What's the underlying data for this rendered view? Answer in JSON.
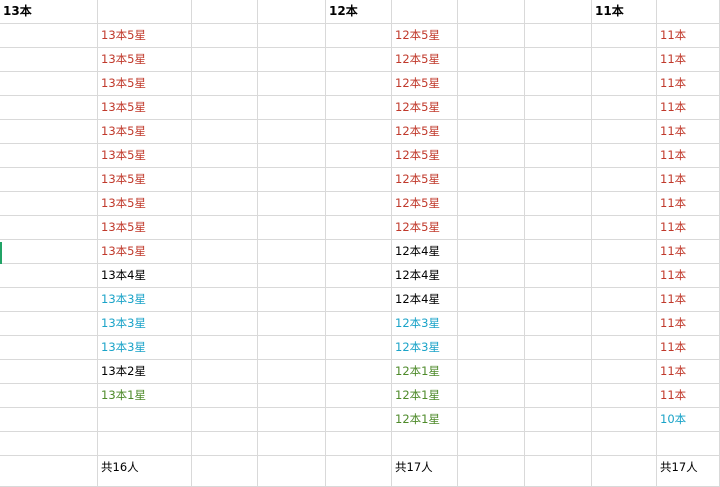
{
  "colors": {
    "red": "#c0392b",
    "black": "#000000",
    "cyan": "#1aa3c8",
    "green": "#4e8a2a",
    "gridline": "#d9d9d9",
    "selection": "#21a366"
  },
  "groups": [
    {
      "header": "13本",
      "total": "共16人",
      "entries": [
        {
          "text": "13本5星",
          "color": "red"
        },
        {
          "text": "13本5星",
          "color": "red"
        },
        {
          "text": "13本5星",
          "color": "red"
        },
        {
          "text": "13本5星",
          "color": "red"
        },
        {
          "text": "13本5星",
          "color": "red"
        },
        {
          "text": "13本5星",
          "color": "red"
        },
        {
          "text": "13本5星",
          "color": "red"
        },
        {
          "text": "13本5星",
          "color": "red"
        },
        {
          "text": "13本5星",
          "color": "red"
        },
        {
          "text": "13本5星",
          "color": "red"
        },
        {
          "text": "13本4星",
          "color": "black"
        },
        {
          "text": "13本3星",
          "color": "cyan"
        },
        {
          "text": "13本3星",
          "color": "cyan"
        },
        {
          "text": "13本3星",
          "color": "cyan"
        },
        {
          "text": "13本2星",
          "color": "black"
        },
        {
          "text": "13本1星",
          "color": "green"
        }
      ]
    },
    {
      "header": "12本",
      "total": "共17人",
      "entries": [
        {
          "text": "12本5星",
          "color": "red"
        },
        {
          "text": "12本5星",
          "color": "red"
        },
        {
          "text": "12本5星",
          "color": "red"
        },
        {
          "text": "12本5星",
          "color": "red"
        },
        {
          "text": "12本5星",
          "color": "red"
        },
        {
          "text": "12本5星",
          "color": "red"
        },
        {
          "text": "12本5星",
          "color": "red"
        },
        {
          "text": "12本5星",
          "color": "red"
        },
        {
          "text": "12本5星",
          "color": "red"
        },
        {
          "text": "12本4星",
          "color": "black"
        },
        {
          "text": "12本4星",
          "color": "black"
        },
        {
          "text": "12本4星",
          "color": "black"
        },
        {
          "text": "12本3星",
          "color": "cyan"
        },
        {
          "text": "12本3星",
          "color": "cyan"
        },
        {
          "text": "12本1星",
          "color": "green"
        },
        {
          "text": "12本1星",
          "color": "green"
        },
        {
          "text": "12本1星",
          "color": "green"
        }
      ]
    },
    {
      "header": "11本",
      "total": "共17人",
      "entries": [
        {
          "text": "11本",
          "color": "red"
        },
        {
          "text": "11本",
          "color": "red"
        },
        {
          "text": "11本",
          "color": "red"
        },
        {
          "text": "11本",
          "color": "red"
        },
        {
          "text": "11本",
          "color": "red"
        },
        {
          "text": "11本",
          "color": "red"
        },
        {
          "text": "11本",
          "color": "red"
        },
        {
          "text": "11本",
          "color": "red"
        },
        {
          "text": "11本",
          "color": "red"
        },
        {
          "text": "11本",
          "color": "red"
        },
        {
          "text": "11本",
          "color": "red"
        },
        {
          "text": "11本",
          "color": "red"
        },
        {
          "text": "11本",
          "color": "red"
        },
        {
          "text": "11本",
          "color": "red"
        },
        {
          "text": "11本",
          "color": "red"
        },
        {
          "text": "11本",
          "color": "red"
        },
        {
          "text": "10本",
          "color": "cyan"
        }
      ]
    }
  ]
}
